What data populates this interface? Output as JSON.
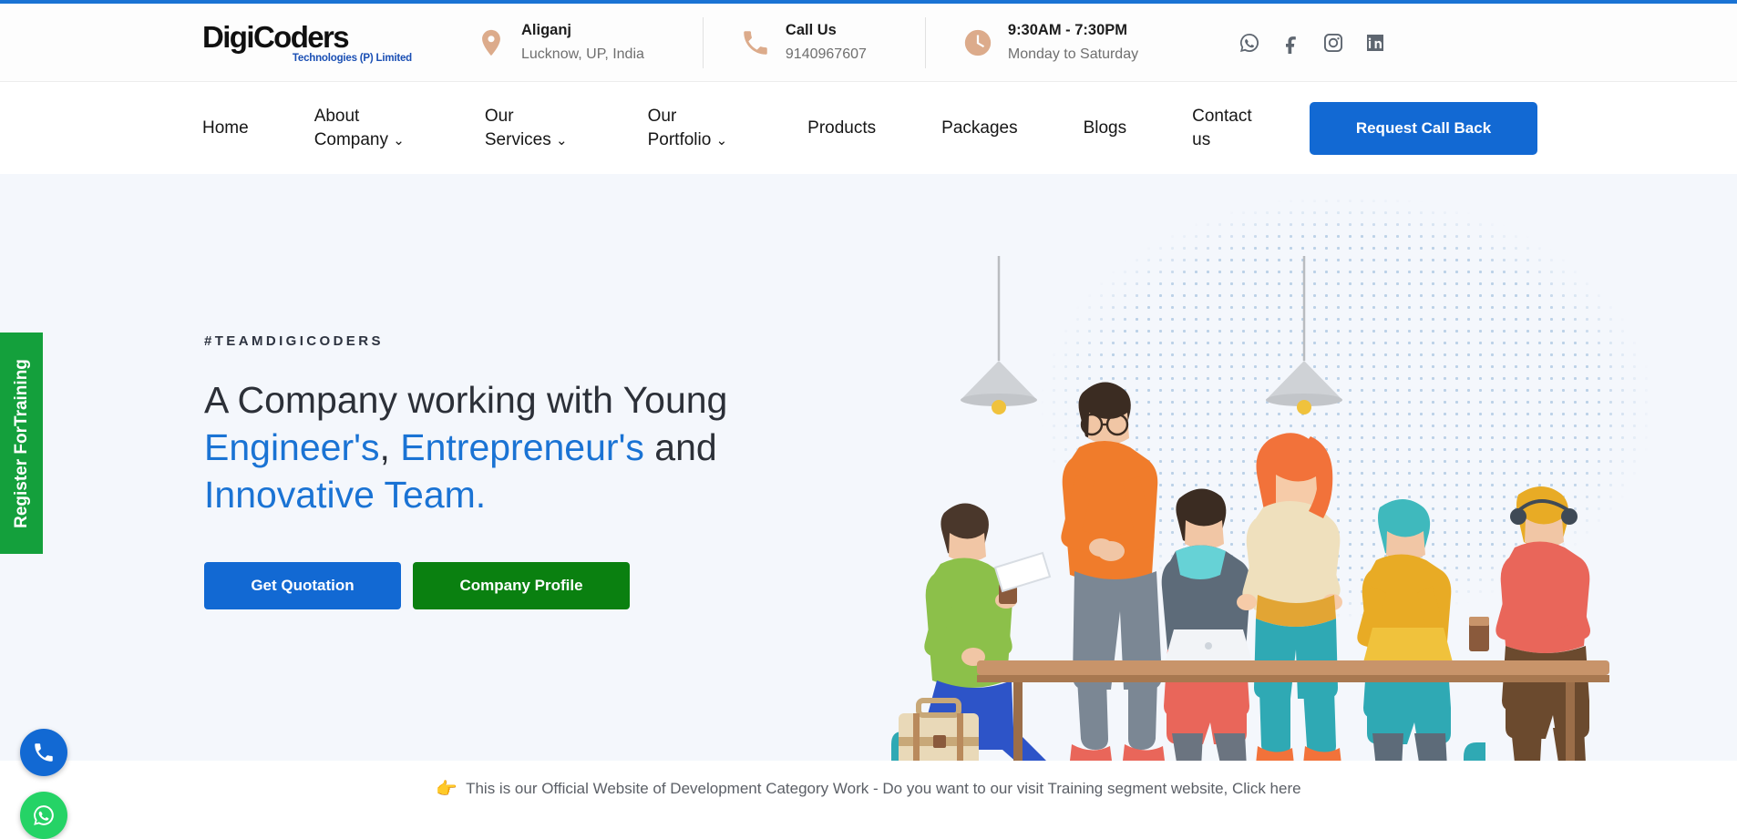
{
  "brand": {
    "logo_main_1": "Digi",
    "logo_main_2": "Coders",
    "logo_sub": "Technologies (P) Limited"
  },
  "topbar": {
    "info": [
      {
        "icon": "location-pin-icon",
        "title": "Aliganj",
        "subtitle": "Lucknow, UP, India"
      },
      {
        "icon": "phone-icon",
        "title": "Call Us",
        "subtitle": "9140967607"
      },
      {
        "icon": "clock-icon",
        "title": "9:30AM - 7:30PM",
        "subtitle": "Monday to Saturday"
      }
    ],
    "socials": [
      {
        "name": "whatsapp-icon",
        "label": "WhatsApp"
      },
      {
        "name": "facebook-icon",
        "label": "Facebook"
      },
      {
        "name": "instagram-icon",
        "label": "Instagram"
      },
      {
        "name": "linkedin-icon",
        "label": "LinkedIn"
      }
    ]
  },
  "nav": {
    "items": [
      {
        "label": "Home",
        "has_dropdown": false
      },
      {
        "label": "About\nCompany",
        "has_dropdown": true
      },
      {
        "label": "Our\nServices",
        "has_dropdown": true
      },
      {
        "label": "Our\nPortfolio",
        "has_dropdown": true
      },
      {
        "label": "Products",
        "has_dropdown": false
      },
      {
        "label": "Packages",
        "has_dropdown": false
      },
      {
        "label": "Blogs",
        "has_dropdown": false
      },
      {
        "label": "Contact\nus",
        "has_dropdown": false
      }
    ],
    "cta_label": "Request Call Back",
    "chevron": "⌄"
  },
  "hero": {
    "eyebrow": "#TEAMDIGICODERS",
    "headline_1": "A Company working with Young ",
    "headline_blue_1": "Engineer's",
    "headline_2": ", ",
    "headline_blue_2": "Entrepreneur's",
    "headline_3": " and",
    "headline_blue_3": "Innovative Team.",
    "btn_quote": "Get Quotation",
    "btn_profile": "Company Profile"
  },
  "banner": {
    "hand_icon": "👉",
    "text": "This is our Official Website of Development Category Work - Do you want to our visit Training segment website, Click here"
  },
  "floating": {
    "side_tab": "Register ForTraining",
    "call_icon": "phone-icon",
    "whatsapp_icon": "whatsapp-icon"
  },
  "colors": {
    "accent_blue": "#1269d3",
    "link_blue": "#1a73d4",
    "green": "#0a8010",
    "tab_green": "#14a03c",
    "whatsapp_green": "#25d366",
    "hero_bg": "#f4f7fc",
    "icon_tan": "#dcab8b"
  }
}
